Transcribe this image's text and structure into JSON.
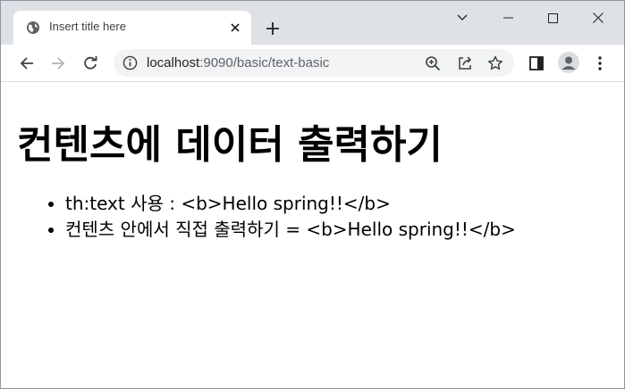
{
  "browser": {
    "tab": {
      "title": "Insert title here",
      "favicon": "globe-icon"
    },
    "new_tab_label": "+",
    "window_controls": [
      "tab-search",
      "minimize",
      "maximize",
      "close"
    ],
    "address_bar": {
      "host": "localhost",
      "rest": ":9090/basic/text-basic"
    },
    "colors": {
      "tabstrip": "#dee1e6",
      "omnibox": "#f1f3f4",
      "icon": "#5f6368"
    }
  },
  "page": {
    "heading": "컨텐츠에 데이터 출력하기",
    "items": [
      "th:text 사용 : <b>Hello spring!!</b>",
      "컨텐츠 안에서 직접 출력하기 = <b>Hello spring!!</b>"
    ]
  }
}
